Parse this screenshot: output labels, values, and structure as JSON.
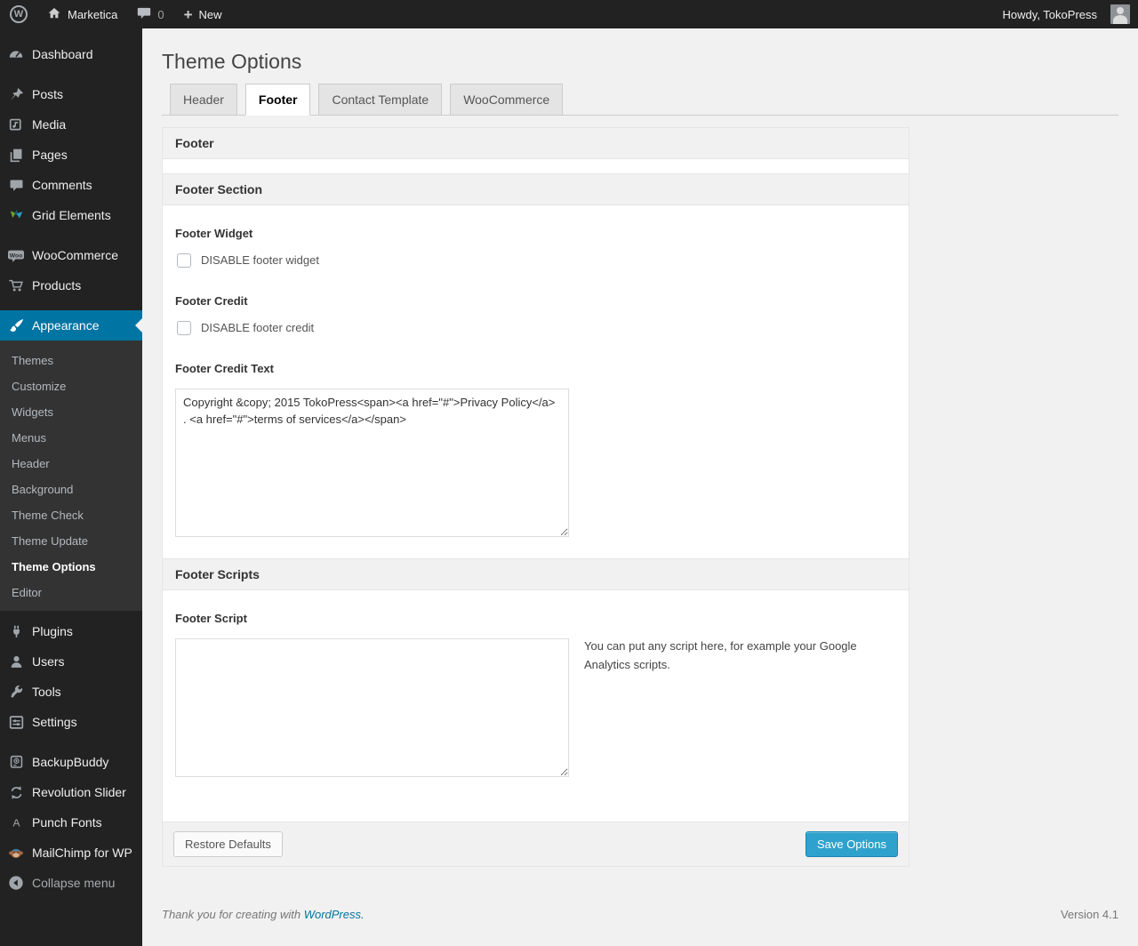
{
  "admin_bar": {
    "site_name": "Marketica",
    "comments_count": "0",
    "new_icon": "+",
    "new_label": "New",
    "howdy": "Howdy, TokoPress"
  },
  "page": {
    "title": "Theme Options"
  },
  "tabs": [
    {
      "label": "Header",
      "active": false
    },
    {
      "label": "Footer",
      "active": true
    },
    {
      "label": "Contact Template",
      "active": false
    },
    {
      "label": "WooCommerce",
      "active": false
    }
  ],
  "sidebar": {
    "items": [
      {
        "label": "Dashboard",
        "icon": "dashboard-icon"
      },
      {
        "label": "Posts",
        "icon": "pushpin-icon"
      },
      {
        "label": "Media",
        "icon": "media-icon"
      },
      {
        "label": "Pages",
        "icon": "pages-icon"
      },
      {
        "label": "Comments",
        "icon": "comments-icon"
      },
      {
        "label": "Grid Elements",
        "icon": "grid-elements-icon"
      },
      {
        "label": "WooCommerce",
        "icon": "woocommerce-icon"
      },
      {
        "label": "Products",
        "icon": "cart-icon"
      },
      {
        "label": "Appearance",
        "icon": "paintbrush-icon",
        "active": true
      },
      {
        "label": "Plugins",
        "icon": "plugin-icon"
      },
      {
        "label": "Users",
        "icon": "user-icon"
      },
      {
        "label": "Tools",
        "icon": "wrench-icon"
      },
      {
        "label": "Settings",
        "icon": "settings-icon"
      },
      {
        "label": "BackupBuddy",
        "icon": "backup-drive-icon"
      },
      {
        "label": "Revolution Slider",
        "icon": "refresh-arrows-icon"
      },
      {
        "label": "Punch Fonts",
        "icon": "letter-a-icon"
      },
      {
        "label": "MailChimp for WP",
        "icon": "mailchimp-monkey-icon"
      },
      {
        "label": "Collapse menu",
        "icon": "collapse-arrow-icon"
      }
    ],
    "appearance_submenu": [
      "Themes",
      "Customize",
      "Widgets",
      "Menus",
      "Header",
      "Background",
      "Theme Check",
      "Theme Update",
      "Theme Options",
      "Editor"
    ],
    "current_submenu": "Theme Options"
  },
  "panel": {
    "title": "Footer",
    "section1_title": "Footer Section",
    "footer_widget_label": "Footer Widget",
    "footer_widget_checkbox": "DISABLE footer widget",
    "footer_credit_label": "Footer Credit",
    "footer_credit_checkbox": "DISABLE footer credit",
    "footer_credit_text_label": "Footer Credit Text",
    "footer_credit_text_value": "Copyright &copy; 2015 TokoPress<span><a href=\"#\">Privacy Policy</a> . <a href=\"#\">terms of services</a></span>",
    "section2_title": "Footer Scripts",
    "footer_script_label": "Footer Script",
    "footer_script_value": "",
    "footer_script_help": "You can put any script here, for example your Google Analytics scripts.",
    "restore_button": "Restore Defaults",
    "save_button": "Save Options"
  },
  "footer": {
    "thanks_prefix": "Thank you for creating with",
    "wordpress_link": "WordPress.",
    "version": "Version 4.1"
  },
  "colors": {
    "admin_bar_bg": "#222222",
    "sidebar_bg": "#222222",
    "submenu_bg": "#333333",
    "accent_blue": "#0074a2",
    "primary_button_blue": "#2ea2cc",
    "content_bg": "#f1f1f1",
    "panel_border": "#e5e5e5"
  }
}
